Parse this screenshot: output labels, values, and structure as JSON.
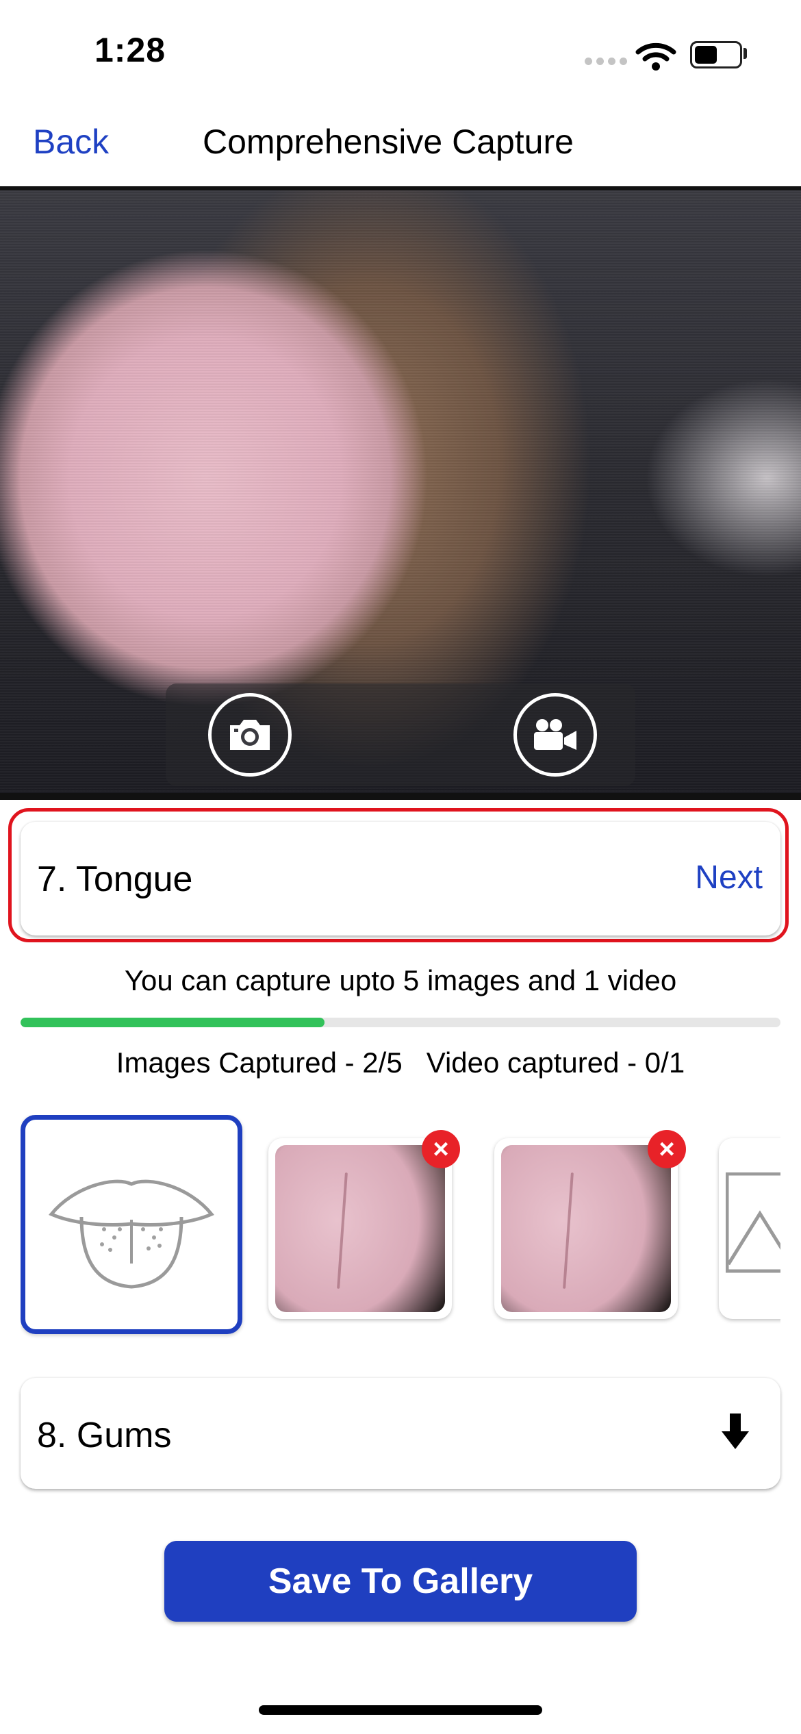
{
  "status_bar": {
    "time": "1:28",
    "icons": [
      "signal-dots-icon",
      "wifi-icon",
      "battery-icon"
    ]
  },
  "nav": {
    "back_label": "Back",
    "title": "Comprehensive Capture"
  },
  "camera": {
    "controls": [
      "camera-icon",
      "video-camera-icon"
    ]
  },
  "current_section": {
    "label": "7. Tongue",
    "next_label": "Next"
  },
  "capture_hint": "You can capture upto 5 images and 1 video",
  "progress": {
    "images_captured": 2,
    "images_max": 5,
    "fraction": 0.4
  },
  "counts_text": "Images Captured - 2/5   Video captured - 0/1",
  "thumbnails": [
    {
      "kind": "guide",
      "icon": "tongue-outline-icon",
      "selected": true
    },
    {
      "kind": "photo",
      "delete_icon": "close-icon"
    },
    {
      "kind": "photo",
      "delete_icon": "close-icon"
    },
    {
      "kind": "placeholder",
      "icon": "image-placeholder-icon"
    }
  ],
  "next_section": {
    "label": "8. Gums",
    "icon": "arrow-down-icon"
  },
  "save_button_label": "Save To Gallery",
  "colors": {
    "accent": "#1f3fc0",
    "link": "#1f41c3",
    "highlight": "#e0141e",
    "progress": "#32c25a",
    "delete": "#e82228"
  }
}
